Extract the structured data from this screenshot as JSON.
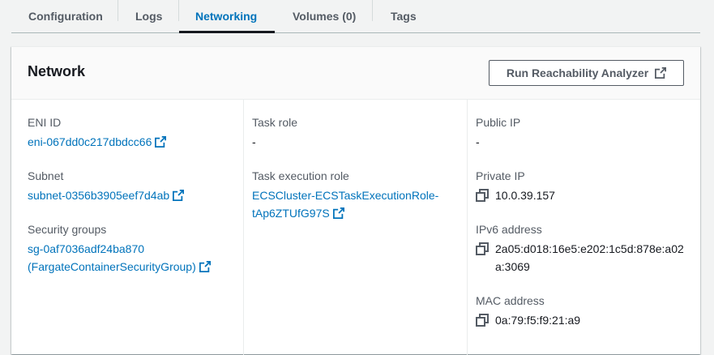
{
  "tabs": [
    {
      "label": "Configuration",
      "active": false
    },
    {
      "label": "Logs",
      "active": false
    },
    {
      "label": "Networking",
      "active": true
    },
    {
      "label": "Volumes (0)",
      "active": false
    },
    {
      "label": "Tags",
      "active": false
    }
  ],
  "network": {
    "title": "Network",
    "run_button_label": "Run Reachability Analyzer",
    "eni": {
      "label": "ENI ID",
      "value": "eni-067dd0c217dbdcc66"
    },
    "subnet": {
      "label": "Subnet",
      "value": "subnet-0356b3905eef7d4ab"
    },
    "security_groups": {
      "label": "Security groups",
      "value_line1": "sg-0af7036adf24ba870",
      "value_line2": "(FargateContainerSecurityGroup)"
    },
    "task_role": {
      "label": "Task role",
      "value": "-"
    },
    "task_execution_role": {
      "label": "Task execution role",
      "value_line1": "ECSCluster-ECSTaskExecutionRole-",
      "value_line2": "tAp6ZTUfG97S"
    },
    "public_ip": {
      "label": "Public IP",
      "value": "-"
    },
    "private_ip": {
      "label": "Private IP",
      "value": "10.0.39.157"
    },
    "ipv6": {
      "label": "IPv6 address",
      "value": "2a05:d018:16e5:e202:1c5d:878e:a02a:3069"
    },
    "mac": {
      "label": "MAC address",
      "value": "0a:79:f5:f9:21:a9"
    }
  },
  "colors": {
    "link": "#0073bb",
    "label": "#545b64",
    "text": "#16191f"
  },
  "icons": {
    "external": "external-link-icon",
    "copy": "copy-icon"
  }
}
